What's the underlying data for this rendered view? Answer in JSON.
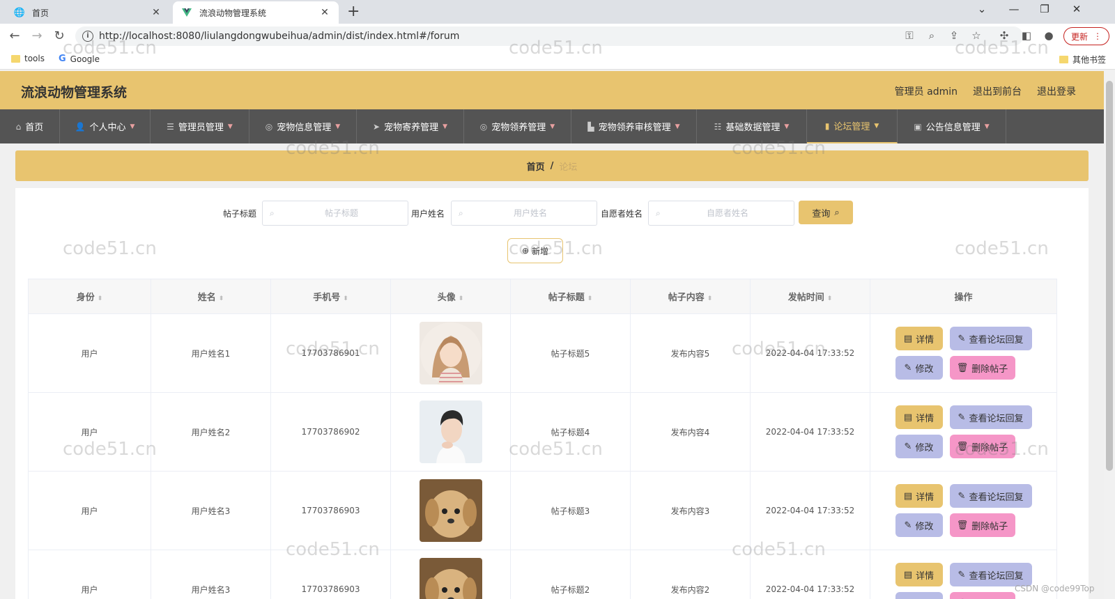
{
  "browser": {
    "tabs": [
      {
        "label": "首页",
        "icon": "globe-icon"
      },
      {
        "label": "流浪动物管理系统",
        "icon": "vue-logo-icon"
      }
    ],
    "url": "http://localhost:8080/liulangdongwubeihua/admin/dist/index.html#/forum",
    "update_label": "更新",
    "bookmarks": [
      {
        "label": "tools"
      },
      {
        "label": "Google"
      }
    ],
    "other_bookmarks": "其他书签"
  },
  "app": {
    "title": "流浪动物管理系统",
    "header_links": {
      "admin": "管理员 admin",
      "front": "退出到前台",
      "logout": "退出登录"
    },
    "menu": [
      {
        "label": "首页",
        "icon": "home-icon",
        "has_caret": false
      },
      {
        "label": "个人中心",
        "icon": "user-icon",
        "has_caret": true
      },
      {
        "label": "管理员管理",
        "icon": "list-icon",
        "has_caret": true
      },
      {
        "label": "宠物信息管理",
        "icon": "compass-icon",
        "has_caret": true
      },
      {
        "label": "宠物寄养管理",
        "icon": "send-icon",
        "has_caret": true
      },
      {
        "label": "宠物领养管理",
        "icon": "compass-icon",
        "has_caret": true
      },
      {
        "label": "宠物领养审核管理",
        "icon": "building-icon",
        "has_caret": true
      },
      {
        "label": "基础数据管理",
        "icon": "sliders-icon",
        "has_caret": true
      },
      {
        "label": "论坛管理",
        "icon": "bar-chart-icon",
        "has_caret": true,
        "active": true
      },
      {
        "label": "公告信息管理",
        "icon": "briefcase-icon",
        "has_caret": true
      }
    ],
    "breadcrumb": {
      "home": "首页",
      "sep": "/",
      "current": "论坛"
    },
    "search": {
      "title_label": "帖子标题",
      "title_placeholder": "帖子标题",
      "user_label": "用户姓名",
      "user_placeholder": "用户姓名",
      "volunteer_label": "自愿者姓名",
      "volunteer_placeholder": "自愿者姓名",
      "query_label": "查询"
    },
    "add_label": "新增",
    "table": {
      "headers": [
        "身份",
        "姓名",
        "手机号",
        "头像",
        "帖子标题",
        "帖子内容",
        "发帖时间",
        "操作"
      ],
      "rows": [
        {
          "role": "用户",
          "name": "用户姓名1",
          "phone": "17703786901",
          "avatar": "woman-avatar",
          "title": "帖子标题5",
          "content": "发布内容5",
          "time": "2022-04-04 17:33:52"
        },
        {
          "role": "用户",
          "name": "用户姓名2",
          "phone": "17703786902",
          "avatar": "man-avatar",
          "title": "帖子标题4",
          "content": "发布内容4",
          "time": "2022-04-04 17:33:52"
        },
        {
          "role": "用户",
          "name": "用户姓名3",
          "phone": "17703786903",
          "avatar": "puppy-avatar",
          "title": "帖子标题3",
          "content": "发布内容3",
          "time": "2022-04-04 17:33:52"
        },
        {
          "role": "用户",
          "name": "用户姓名3",
          "phone": "17703786903",
          "avatar": "puppy-avatar",
          "title": "帖子标题2",
          "content": "发布内容2",
          "time": "2022-04-04 17:33:52"
        }
      ],
      "actions": {
        "detail": "详情",
        "reply": "查看论坛回复",
        "edit": "修改",
        "delete": "删除帖子"
      }
    },
    "watermark": "code51.cn",
    "csdn_credit": "CSDN @code99Top"
  },
  "colors": {
    "accent": "#e8c46f",
    "menu_bg": "#545454",
    "reply_btn": "#b8bce6",
    "delete_btn": "#f596c7"
  }
}
